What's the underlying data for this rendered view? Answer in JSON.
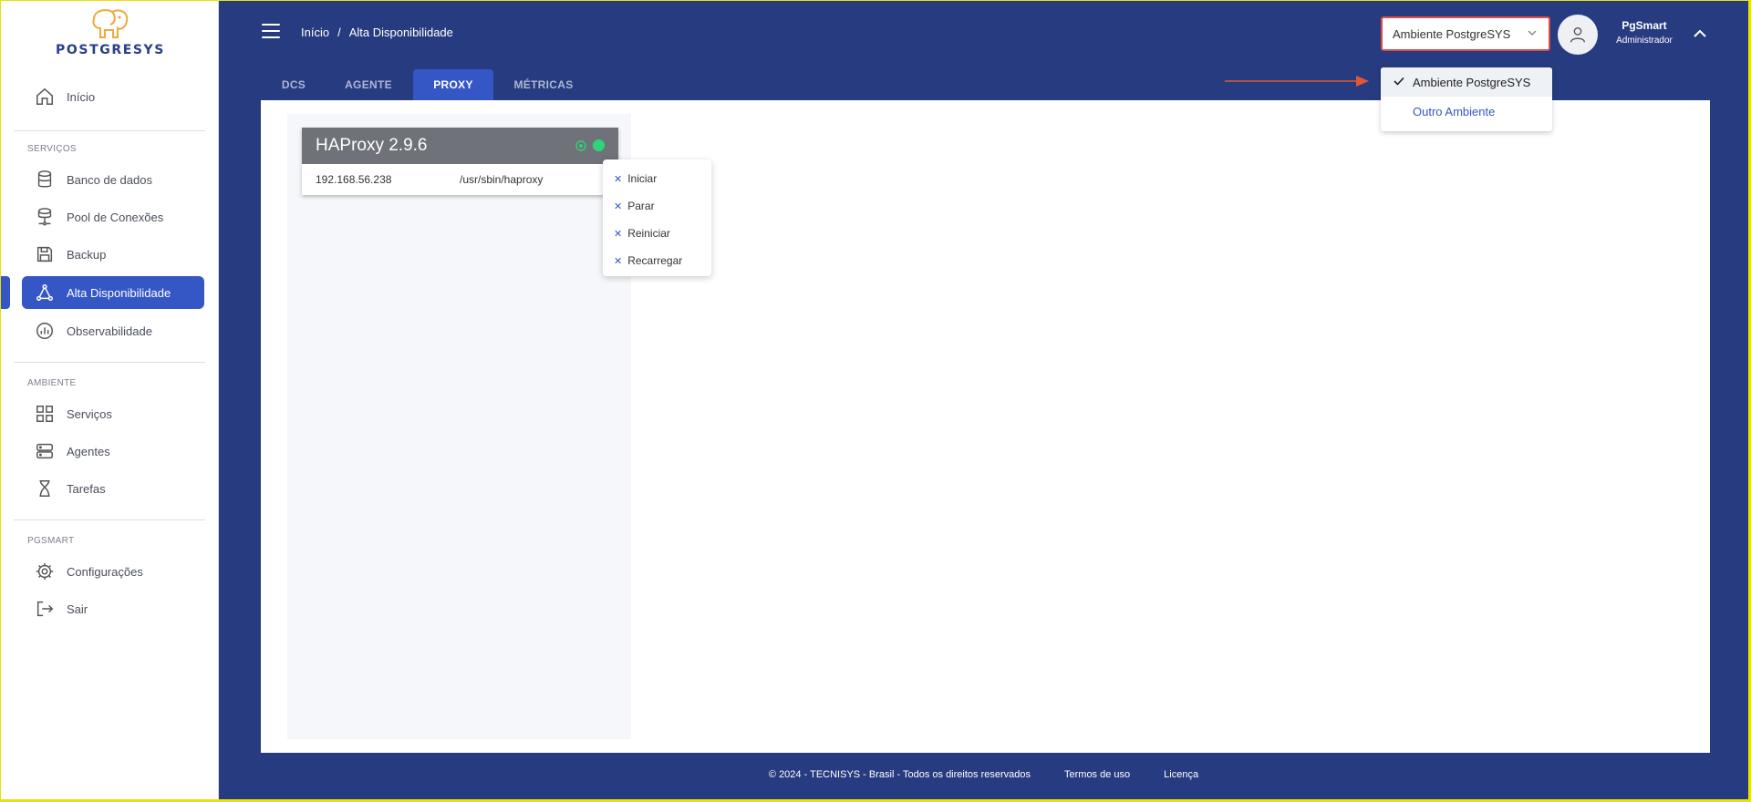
{
  "brand": {
    "logo_text": "POSTGRESYS"
  },
  "sidebar": {
    "home": "Início",
    "sections": [
      {
        "label": "SERVIÇOS",
        "items": [
          "Banco de dados",
          "Pool de Conexões",
          "Backup",
          "Alta Disponibilidade",
          "Observabilidade"
        ]
      },
      {
        "label": "AMBIENTE",
        "items": [
          "Serviços",
          "Agentes",
          "Tarefas"
        ]
      },
      {
        "label": "PGSMART",
        "items": [
          "Configurações",
          "Sair"
        ]
      }
    ],
    "active_item": "Alta Disponibilidade"
  },
  "header": {
    "breadcrumb": [
      "Início",
      "/",
      "Alta Disponibilidade"
    ],
    "environment_selected": "Ambiente PostgreSYS",
    "user_name": "PgSmart",
    "user_role": "Administrador"
  },
  "tabs": [
    "DCS",
    "AGENTE",
    "PROXY",
    "MÉTRICAS"
  ],
  "active_tab": "PROXY",
  "proxy_card": {
    "title": "HAProxy 2.9.6",
    "ip": "192.168.56.238",
    "path": "/usr/sbin/haproxy"
  },
  "actions": [
    "Iniciar",
    "Parar",
    "Reiniciar",
    "Recarregar"
  ],
  "environment_options": [
    "Ambiente PostgreSYS",
    "Outro Ambiente"
  ],
  "footer": {
    "copyright": "© 2024 - TECNISYS - Brasil - Todos os direitos reservados",
    "terms": "Termos de uso",
    "license": "Licença"
  },
  "colors": {
    "brand_blue": "#273b80",
    "accent": "#3457c5",
    "status_green": "#2ed47a",
    "highlight_red": "#e04a4a"
  }
}
